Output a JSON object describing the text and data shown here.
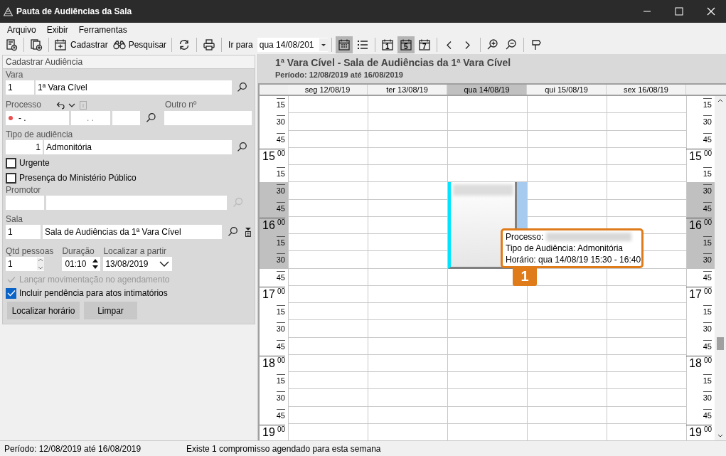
{
  "window": {
    "title": "Pauta de Audiências da Sala"
  },
  "menu": [
    {
      "label": "Arquivo"
    },
    {
      "label": "Exibir"
    },
    {
      "label": "Ferramentas"
    }
  ],
  "toolbar": {
    "cadastrar": "Cadastrar",
    "pesquisar": "Pesquisar",
    "goto_label": "Ir para",
    "goto_value": "qua 14/08/201",
    "view_modes": [
      {
        "selected": true
      },
      {
        "selected": false
      }
    ],
    "day_counts": [
      {
        "label": "1",
        "selected": false
      },
      {
        "label": "5",
        "selected": true
      },
      {
        "label": "7",
        "selected": false
      }
    ]
  },
  "form": {
    "title": "Cadastrar Audiência",
    "vara": {
      "label": "Vara",
      "code": "1",
      "name": "1ª Vara Cível"
    },
    "processo": {
      "label": "Processo",
      "part_1": "- .",
      "part_2": ". ."
    },
    "outro": {
      "label": "Outro nº"
    },
    "tipo": {
      "label": "Tipo de audiência",
      "code": "1",
      "name": "Admonitória"
    },
    "checkboxes": [
      {
        "label": "Urgente",
        "checked": false
      },
      {
        "label": "Presença do Ministério Público",
        "checked": false
      }
    ],
    "promotor": {
      "label": "Promotor"
    },
    "sala": {
      "label": "Sala",
      "code": "1",
      "name": "Sala de Audiências da 1ª Vara Cível"
    },
    "qtd": {
      "label": "Qtd pessoas",
      "value": "1"
    },
    "duracao": {
      "label": "Duração",
      "value": "01:10"
    },
    "localizar": {
      "label": "Localizar a partir",
      "value": "13/08/2019"
    },
    "options": [
      {
        "label": "Lançar movimentação no agendamento",
        "checked": true,
        "disabled": true
      },
      {
        "label": "Incluir pendência para atos intimatórios",
        "checked": true,
        "disabled": false
      }
    ],
    "buttons": [
      {
        "label": "Localizar horário"
      },
      {
        "label": "Limpar"
      }
    ]
  },
  "schedule": {
    "title": "1ª Vara Cível - Sala de Audiências da 1ª Vara Cível",
    "period": "Período: 12/08/2019 até 16/08/2019",
    "days": [
      {
        "label": "seg 12/08/19",
        "selected": false,
        "has_appointment": false
      },
      {
        "label": "ter 13/08/19",
        "selected": false,
        "has_appointment": false
      },
      {
        "label": "qua 14/08/19",
        "selected": true,
        "has_appointment": true
      },
      {
        "label": "qui 15/08/19",
        "selected": false,
        "has_appointment": false
      },
      {
        "label": "sex 16/08/19",
        "selected": false,
        "has_appointment": false
      }
    ],
    "rows": [
      {
        "left": {
          "minute": "15"
        },
        "right": {
          "minute": "15"
        },
        "highlighted": false
      },
      {
        "left": {
          "minute": "30"
        },
        "right": {
          "minute": "30"
        },
        "highlighted": false
      },
      {
        "left": {
          "minute": "45"
        },
        "right": {
          "minute": "45"
        },
        "highlighted": false
      },
      {
        "left": {
          "hour": "15",
          "minute": "00"
        },
        "right": {
          "hour": "15",
          "minute": "00"
        },
        "highlighted": false
      },
      {
        "left": {
          "minute": "15"
        },
        "right": {
          "minute": "15"
        },
        "highlighted": false
      },
      {
        "left": {
          "minute": "30"
        },
        "right": {
          "minute": "30"
        },
        "highlighted": true
      },
      {
        "left": {
          "minute": "45"
        },
        "right": {
          "minute": "45"
        },
        "highlighted": true
      },
      {
        "left": {
          "hour": "16",
          "minute": "00"
        },
        "right": {
          "hour": "16",
          "minute": "00"
        },
        "highlighted": true
      },
      {
        "left": {
          "minute": "15"
        },
        "right": {
          "minute": "15"
        },
        "highlighted": true
      },
      {
        "left": {
          "minute": "30"
        },
        "right": {
          "minute": "30"
        },
        "highlighted": true
      },
      {
        "left": {
          "minute": "45"
        },
        "right": {
          "minute": "45"
        },
        "highlighted": false
      },
      {
        "left": {
          "hour": "17",
          "minute": "00"
        },
        "right": {
          "hour": "17",
          "minute": "00"
        },
        "highlighted": false
      },
      {
        "left": {
          "minute": "15"
        },
        "right": {
          "minute": "15"
        },
        "highlighted": false
      },
      {
        "left": {
          "minute": "30"
        },
        "right": {
          "minute": "30"
        },
        "highlighted": false
      },
      {
        "left": {
          "minute": "45"
        },
        "right": {
          "minute": "45"
        },
        "highlighted": false
      },
      {
        "left": {
          "hour": "18",
          "minute": "00"
        },
        "right": {
          "hour": "18",
          "minute": "00"
        },
        "highlighted": false
      },
      {
        "left": {
          "minute": "15"
        },
        "right": {
          "minute": "15"
        },
        "highlighted": false
      },
      {
        "left": {
          "minute": "30"
        },
        "right": {
          "minute": "30"
        },
        "highlighted": false
      },
      {
        "left": {
          "minute": "45"
        },
        "right": {
          "minute": "45"
        },
        "highlighted": false
      },
      {
        "left": {
          "hour": "19",
          "minute": "00"
        },
        "right": {
          "hour": "19",
          "minute": "00"
        },
        "highlighted": false
      }
    ],
    "tooltip": {
      "lines": [
        "Processo:",
        "Tipo de Audiência: Admonitória",
        "Horário: qua 14/08/19 15:30 - 16:40"
      ],
      "badge": "1"
    }
  },
  "status_bar": {
    "period": "Período: 12/08/2019 até 16/08/2019",
    "message": "Existe 1 compromisso agendado para esta semana"
  }
}
